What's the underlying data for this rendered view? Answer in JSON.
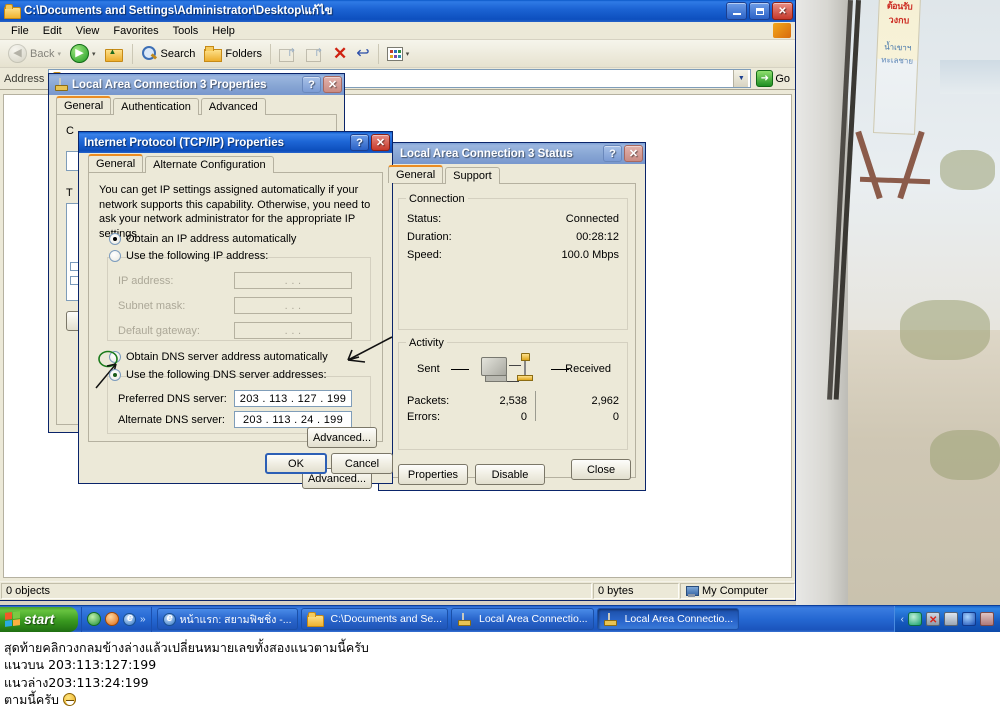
{
  "explorer": {
    "title": "C:\\Documents and Settings\\Administrator\\Desktop\\แก้ไข",
    "title_icon": "folder-icon",
    "min_label": "_",
    "max_label": "□",
    "close_label": "✕",
    "menus": [
      "File",
      "Edit",
      "View",
      "Favorites",
      "Tools",
      "Help"
    ],
    "toolbar": {
      "back": "Back",
      "search": "Search",
      "folders": "Folders",
      "icons": [
        "back-icon",
        "forward-icon",
        "up-one-level-icon",
        "search-icon",
        "folders-icon",
        "move-to-icon",
        "copy-to-icon",
        "delete-icon",
        "undo-icon",
        "views-icon"
      ]
    },
    "address": {
      "label": "Address",
      "value": "",
      "placeholder": "",
      "go_label": "Go"
    },
    "statusbar": {
      "objects": "0 objects",
      "size": "0 bytes",
      "zone": "My Computer"
    }
  },
  "dlg_lac3_props": {
    "title": "Local Area Connection 3 Properties",
    "tabs": [
      "General",
      "Authentication",
      "Advanced"
    ],
    "selected_tab": "General",
    "help_label": "?",
    "close_label": "✕"
  },
  "dlg_status": {
    "title": "Local Area Connection 3 Status",
    "tabs": [
      "General",
      "Support"
    ],
    "selected_tab": "General",
    "help_label": "?",
    "close_label": "✕",
    "connection_group": "Connection",
    "connection_rows": [
      {
        "label": "Status:",
        "value": "Connected"
      },
      {
        "label": "Duration:",
        "value": "00:28:12"
      },
      {
        "label": "Speed:",
        "value": "100.0 Mbps"
      }
    ],
    "activity_group": "Activity",
    "activity_sent": "Sent",
    "activity_received": "Received",
    "activity_rows": [
      {
        "label": "Packets:",
        "sent": "2,538",
        "received": "2,962"
      },
      {
        "label": "Errors:",
        "sent": "0",
        "received": "0"
      }
    ],
    "buttons": {
      "properties": "Properties",
      "disable": "Disable",
      "close": "Close"
    }
  },
  "dlg_tcpip": {
    "title": "Internet Protocol (TCP/IP) Properties",
    "help_label": "?",
    "close_label": "✕",
    "tabs": [
      "General",
      "Alternate Configuration"
    ],
    "selected_tab": "General",
    "intro": "You can get IP settings assigned automatically if your network supports this capability. Otherwise, you need to ask your network administrator for the appropriate IP settings.",
    "ip_auto_label": "Obtain an IP address automatically",
    "ip_manual_label": "Use the following IP address:",
    "ip_auto_selected": true,
    "ip_fields": [
      {
        "label": "IP address:",
        "value": ".    .    ."
      },
      {
        "label": "Subnet mask:",
        "value": ".    .    ."
      },
      {
        "label": "Default gateway:",
        "value": ".    .    ."
      }
    ],
    "dns_auto_label": "Obtain DNS server address automatically",
    "dns_manual_label": "Use the following DNS server addresses:",
    "dns_manual_selected": true,
    "dns_fields": [
      {
        "label": "Preferred DNS server:",
        "value": "203 . 113 . 127 . 199"
      },
      {
        "label": "Alternate DNS server:",
        "value": "203 . 113 .  24 . 199"
      }
    ],
    "advanced_label": "Advanced...",
    "ok_label": "OK",
    "cancel_label": "Cancel"
  },
  "taskbar": {
    "start_label": "start",
    "quicklaunch": [
      "show-desktop-icon",
      "firefox-icon",
      "internet-explorer-icon",
      "chevron-right-icon"
    ],
    "tasks": [
      {
        "label": "หน้าแรก: สยามฟิชชิ่ง -...",
        "icon": "internet-explorer-icon",
        "active": false
      },
      {
        "label": "C:\\Documents and Se...",
        "icon": "folder-icon",
        "active": false
      },
      {
        "label": "Local Area Connectio...",
        "icon": "network-icon",
        "active": false
      },
      {
        "label": "Local Area Connectio...",
        "icon": "network-icon",
        "active": true
      }
    ],
    "tray_icons": [
      "chevron-left-icon",
      "messenger-icon",
      "network-disconnected-icon",
      "network-activity-icon",
      "bluetooth-icon",
      "display-icon"
    ]
  },
  "caption": {
    "lines": [
      "สุดท้ายคลิกวงกลมข้างล่างแล้วเปลี่ยนหมายเลขทั้งสองแนวตามนี้ครับ",
      "แนวบน  203:113:127:199",
      "แนวล่าง203:113:24:199",
      "ตามนี้ครับ "
    ]
  },
  "colors": {
    "xp_title_blue": "#0a59c8",
    "xp_face": "#ece9d8",
    "accent_orange": "#eb8c22",
    "taskbar_blue": "#2568d2",
    "start_green": "#39991f",
    "delete_red": "#cf2211",
    "annot_green": "#1a8a1a"
  }
}
